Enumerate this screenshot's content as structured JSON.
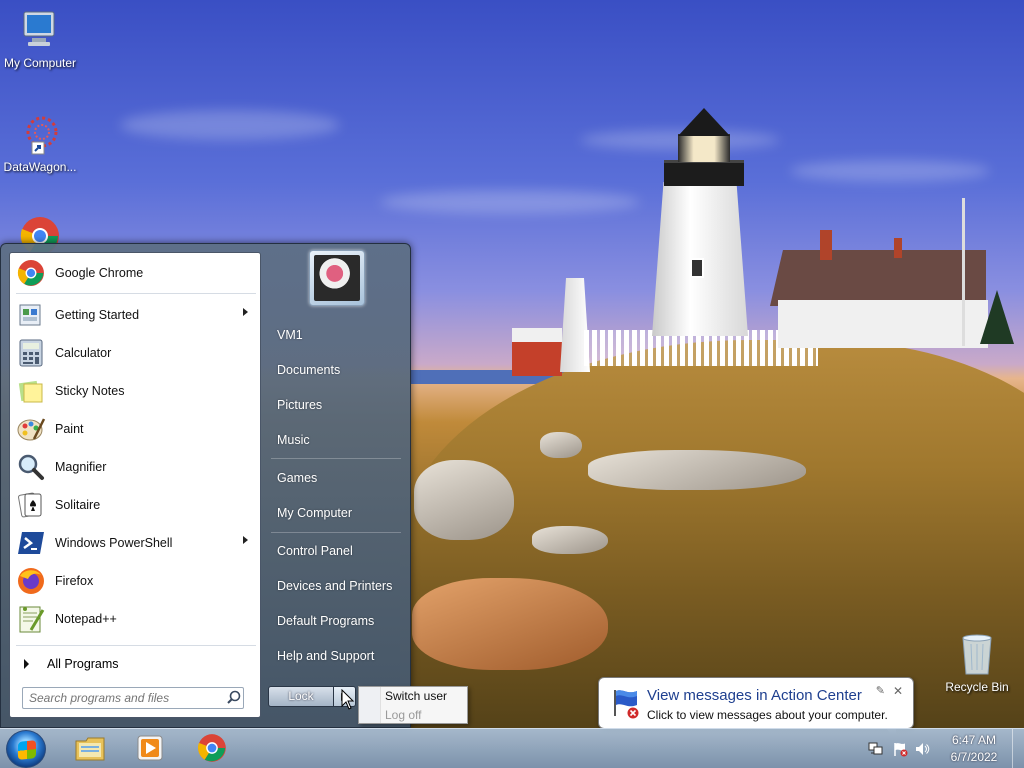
{
  "desktop": {
    "icons": [
      {
        "label": "My Computer",
        "icon": "computer-icon"
      },
      {
        "label": "DataWagon...",
        "icon": "datawagon-icon"
      },
      {
        "label": "",
        "icon": "chrome-icon"
      }
    ],
    "recycle_bin": {
      "label": "Recycle Bin",
      "icon": "recycle-bin-icon"
    }
  },
  "start_menu": {
    "programs": [
      {
        "label": "Google Chrome",
        "icon": "chrome-icon",
        "submenu": false
      },
      {
        "label": "Getting Started",
        "icon": "getting-started-icon",
        "submenu": true
      },
      {
        "label": "Calculator",
        "icon": "calculator-icon",
        "submenu": false
      },
      {
        "label": "Sticky Notes",
        "icon": "sticky-notes-icon",
        "submenu": false
      },
      {
        "label": "Paint",
        "icon": "paint-icon",
        "submenu": false
      },
      {
        "label": "Magnifier",
        "icon": "magnifier-icon",
        "submenu": false
      },
      {
        "label": "Solitaire",
        "icon": "solitaire-icon",
        "submenu": false
      },
      {
        "label": "Windows PowerShell",
        "icon": "powershell-icon",
        "submenu": true
      },
      {
        "label": "Firefox",
        "icon": "firefox-icon",
        "submenu": false
      },
      {
        "label": "Notepad++",
        "icon": "notepadpp-icon",
        "submenu": false
      }
    ],
    "all_programs": "All Programs",
    "search": {
      "placeholder": "Search programs and files"
    },
    "right_links": [
      {
        "label": "VM1"
      },
      {
        "label": "Documents"
      },
      {
        "label": "Pictures"
      },
      {
        "label": "Music"
      },
      {
        "label": "Games"
      },
      {
        "label": "My Computer"
      },
      {
        "label": "Control Panel"
      },
      {
        "label": "Devices and Printers"
      },
      {
        "label": "Default Programs"
      },
      {
        "label": "Help and Support"
      }
    ],
    "lock_button": "Lock",
    "power_menu": {
      "switch_user": "Switch user",
      "log_off": "Log off"
    }
  },
  "balloon": {
    "title": "View messages in Action Center",
    "text": "Click to view messages about your computer.",
    "close": "✕",
    "pin": "✎"
  },
  "taskbar": {
    "pinned": [
      {
        "icon": "explorer-icon"
      },
      {
        "icon": "media-player-icon"
      },
      {
        "icon": "chrome-icon"
      }
    ],
    "clock": {
      "time": "6:47 AM",
      "date": "6/7/2022"
    }
  },
  "colors": {
    "balloon_title": "#1e3f8f",
    "taskbar": "#8ea4be",
    "start_menu_glass": "#5c6e82"
  }
}
